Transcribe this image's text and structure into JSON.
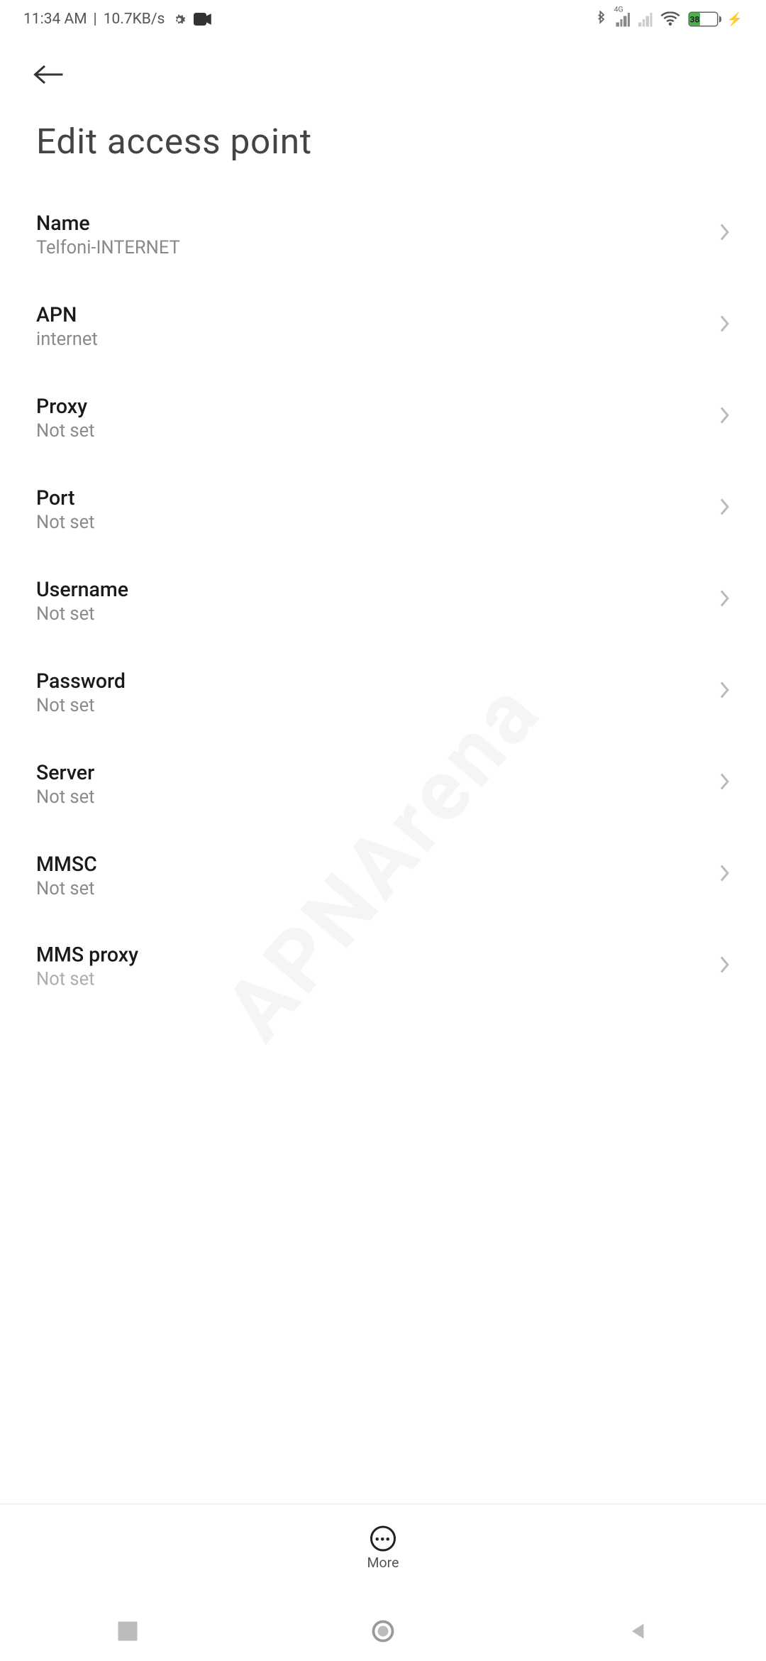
{
  "statusBar": {
    "time": "11:34 AM",
    "speed": "10.7KB/s",
    "network4g": "4G",
    "battery": "38"
  },
  "header": {
    "title": "Edit access point"
  },
  "items": [
    {
      "label": "Name",
      "value": "Telfoni-INTERNET"
    },
    {
      "label": "APN",
      "value": "internet"
    },
    {
      "label": "Proxy",
      "value": "Not set"
    },
    {
      "label": "Port",
      "value": "Not set"
    },
    {
      "label": "Username",
      "value": "Not set"
    },
    {
      "label": "Password",
      "value": "Not set"
    },
    {
      "label": "Server",
      "value": "Not set"
    },
    {
      "label": "MMSC",
      "value": "Not set"
    },
    {
      "label": "MMS proxy",
      "value": "Not set"
    }
  ],
  "bottom": {
    "more": "More"
  },
  "watermark": "APNArena"
}
